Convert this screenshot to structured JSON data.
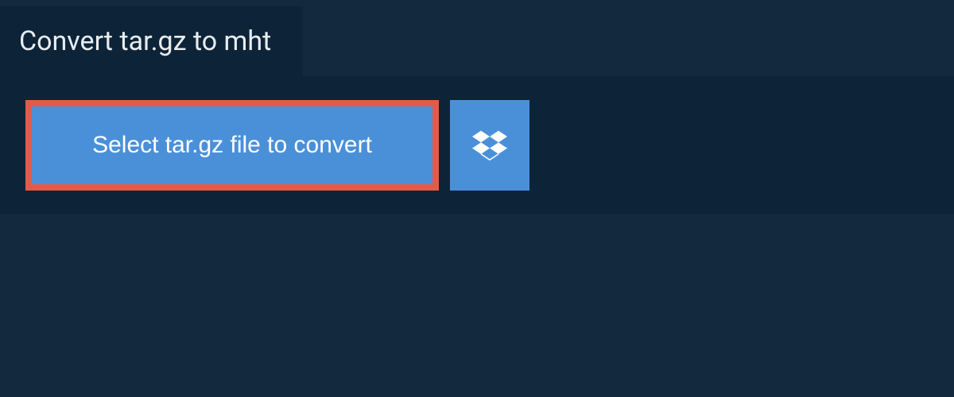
{
  "header": {
    "title": "Convert tar.gz to mht"
  },
  "upload": {
    "select_button_label": "Select tar.gz file to convert",
    "dropbox_icon_name": "dropbox-icon"
  },
  "colors": {
    "page_bg": "#13293d",
    "panel_bg": "#0d2438",
    "button_bg": "#4a90d9",
    "highlight_border": "#e25b4a",
    "text_light": "#e8edf2",
    "text_white": "#ffffff"
  }
}
